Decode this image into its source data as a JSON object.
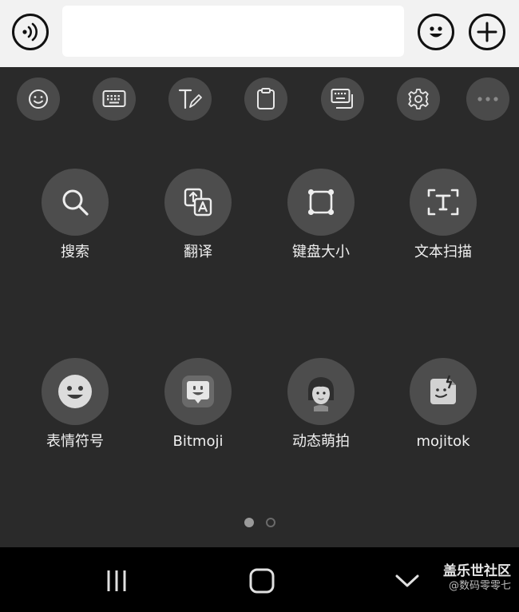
{
  "top_bar": {
    "voice_icon": "voice-input-icon",
    "message_value": "",
    "message_placeholder": "",
    "emoji_icon": "smiley-icon",
    "add_icon": "plus-icon"
  },
  "toolbar": [
    {
      "name": "emoji-toolbar-button",
      "icon": "smiley-icon"
    },
    {
      "name": "keyboard-toolbar-button",
      "icon": "keyboard-icon"
    },
    {
      "name": "handwriting-toolbar-button",
      "icon": "handwriting-icon"
    },
    {
      "name": "clipboard-toolbar-button",
      "icon": "clipboard-icon"
    },
    {
      "name": "keyboard-mode-toolbar-button",
      "icon": "keyboard-mode-icon"
    },
    {
      "name": "settings-toolbar-button",
      "icon": "gear-icon"
    },
    {
      "name": "more-toolbar-button",
      "icon": "more-icon"
    }
  ],
  "grid": {
    "search": {
      "label": "搜索",
      "icon": "search-icon"
    },
    "translate": {
      "label": "翻译",
      "icon": "translate-icon"
    },
    "keyboard_size": {
      "label": "键盘大小",
      "icon": "resize-icon"
    },
    "text_scan": {
      "label": "文本扫描",
      "icon": "text-scan-icon"
    },
    "emoji": {
      "label": "表情符号",
      "icon": "emoji-face-icon"
    },
    "bitmoji": {
      "label": "Bitmoji",
      "icon": "bitmoji-icon"
    },
    "ar_emoji": {
      "label": "动态萌拍",
      "icon": "avatar-icon"
    },
    "mojitok": {
      "label": "mojitok",
      "icon": "mojitok-icon"
    }
  },
  "pagination": {
    "current_page": 1,
    "total_pages": 2
  },
  "nav": {
    "recents_icon": "recent-apps-icon",
    "home_icon": "home-icon",
    "back_icon": "chevron-down-icon"
  },
  "watermark": {
    "title": "盖乐世社区",
    "subtitle": "@数码零零七"
  },
  "colors": {
    "toolbar_bg": "#f2f2f2",
    "keyboard_bg": "#2a2a2a",
    "button_bg": "#4d4d4d",
    "nav_bg": "#000000"
  }
}
